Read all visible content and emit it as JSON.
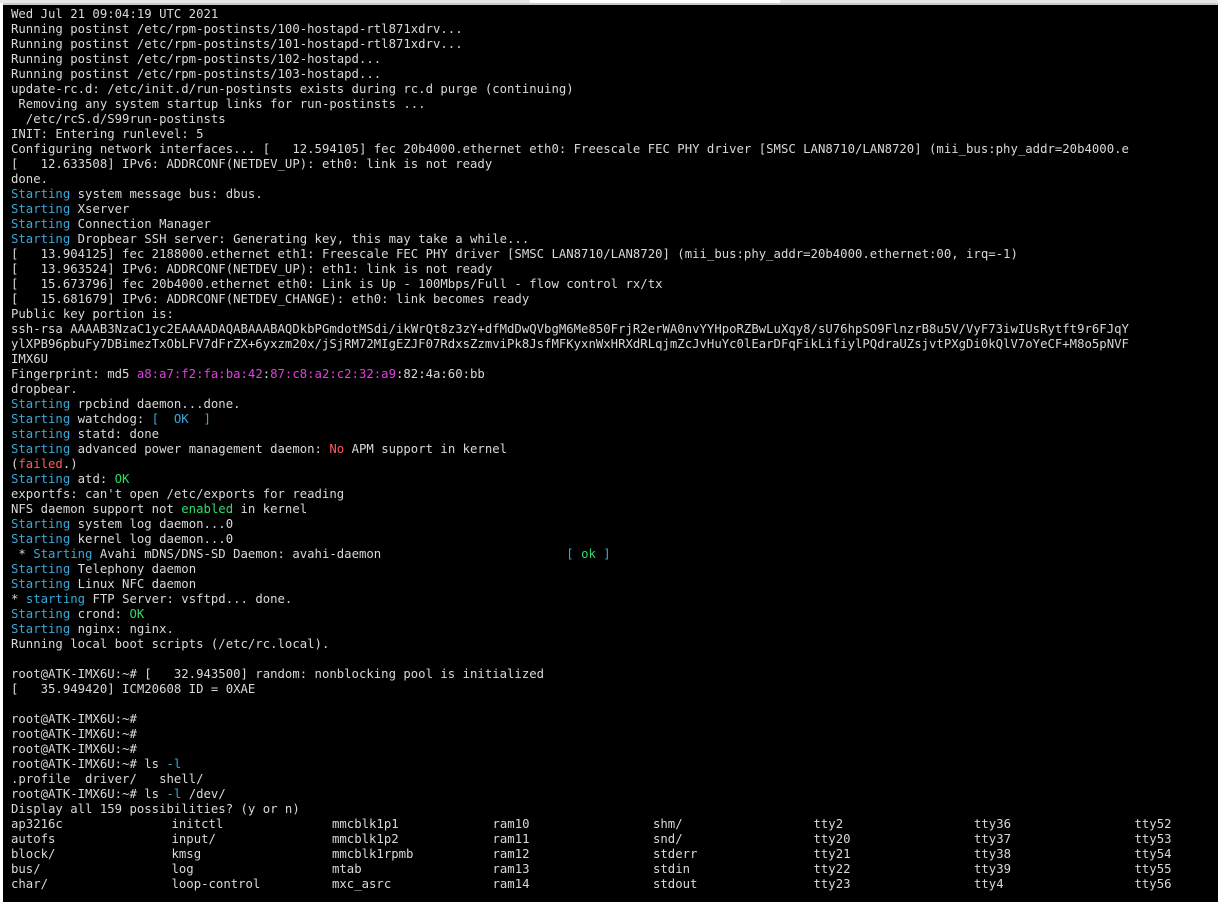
{
  "colors": {
    "default": "#d9d9d9",
    "cyan": "#3aa8d8",
    "green": "#2fdc6a",
    "red": "#ff5a5a",
    "magenta": "#e040e0",
    "background": "#000000"
  },
  "terminal": {
    "lines": [
      [
        {
          "t": "Wed Jul 21 09:04:19 UTC 2021"
        }
      ],
      [
        {
          "t": "Running postinst /etc/rpm-postinsts/100-hostapd-rtl871xdrv..."
        }
      ],
      [
        {
          "t": "Running postinst /etc/rpm-postinsts/101-hostapd-rtl871xdrv..."
        }
      ],
      [
        {
          "t": "Running postinst /etc/rpm-postinsts/102-hostapd..."
        }
      ],
      [
        {
          "t": "Running postinst /etc/rpm-postinsts/103-hostapd..."
        }
      ],
      [
        {
          "t": "update-rc.d: /etc/init.d/run-postinsts exists during rc.d purge (continuing)"
        }
      ],
      [
        {
          "t": " Removing any system startup links for run-postinsts ..."
        }
      ],
      [
        {
          "t": "  /etc/rcS.d/S99run-postinsts"
        }
      ],
      [
        {
          "t": "INIT: Entering runlevel: 5"
        }
      ],
      [
        {
          "t": "Configuring network interfaces... [   12.594105] fec 20b4000.ethernet eth0: Freescale FEC PHY driver [SMSC LAN8710/LAN8720] (mii_bus:phy_addr=20b4000.e"
        }
      ],
      [
        {
          "t": "[   12.633508] IPv6: ADDRCONF(NETDEV_UP): eth0: link is not ready"
        }
      ],
      [
        {
          "t": "done."
        }
      ],
      [
        {
          "t": "Starting",
          "c": "cyan"
        },
        {
          "t": " system message bus: dbus."
        }
      ],
      [
        {
          "t": "Starting",
          "c": "cyan"
        },
        {
          "t": " Xserver"
        }
      ],
      [
        {
          "t": "Starting",
          "c": "cyan"
        },
        {
          "t": " Connection Manager"
        }
      ],
      [
        {
          "t": "Starting",
          "c": "cyan"
        },
        {
          "t": " Dropbear SSH server: Generating key, this may take a while..."
        }
      ],
      [
        {
          "t": "[   13.904125] fec 2188000.ethernet eth1: Freescale FEC PHY driver [SMSC LAN8710/LAN8720] (mii_bus:phy_addr=20b4000.ethernet:00, irq=-1)"
        }
      ],
      [
        {
          "t": "[   13.963524] IPv6: ADDRCONF(NETDEV_UP): eth1: link is not ready"
        }
      ],
      [
        {
          "t": "[   15.673796] fec 20b4000.ethernet eth0: Link is Up - 100Mbps/Full - flow control rx/tx"
        }
      ],
      [
        {
          "t": "[   15.681679] IPv6: ADDRCONF(NETDEV_CHANGE): eth0: link becomes ready"
        }
      ],
      [
        {
          "t": "Public key portion is:"
        }
      ],
      [
        {
          "t": "ssh-rsa AAAAB3NzaC1yc2EAAAADAQABAAABAQDkbPGmdotMSdi/ikWrQt8z3zY+dfMdDwQVbgM6Me850FrjR2erWA0nvYYHpoRZBwLuXqy8/sU76hpSO9FlnzrB8u5V/VyF73iwIUsRytft9r6FJqY"
        }
      ],
      [
        {
          "t": "ylXPB96pbuFy7DBimezTxObLFV7dFrZX+6yxzm20x/jSjRM72MIgEZJF07RdxsZzmviPk8JsfMFKyxnWxHRXdRLqjmZcJvHuYc0lEarDFqFikLifiylPQdraUZsjvtPXgDi0kQlV7oYeCF+M8o5pNVF"
        }
      ],
      [
        {
          "t": "IMX6U"
        }
      ],
      [
        {
          "t": "Fingerprint: md5 "
        },
        {
          "t": "a8:a7:f2:fa:ba:42",
          "c": "magenta"
        },
        {
          "t": ":"
        },
        {
          "t": "87:c8:a2:c2:32:a9",
          "c": "magenta"
        },
        {
          "t": ":82:4a:60:bb"
        }
      ],
      [
        {
          "t": "dropbear."
        }
      ],
      [
        {
          "t": "Starting",
          "c": "cyan"
        },
        {
          "t": " rpcbind daemon...done."
        }
      ],
      [
        {
          "t": "Starting",
          "c": "cyan"
        },
        {
          "t": " watchdog: "
        },
        {
          "t": "[  OK  ]",
          "c": "cyan"
        }
      ],
      [
        {
          "t": "starting",
          "c": "cyan"
        },
        {
          "t": " statd: done"
        }
      ],
      [
        {
          "t": "Starting",
          "c": "cyan"
        },
        {
          "t": " advanced power management daemon: "
        },
        {
          "t": "No",
          "c": "red"
        },
        {
          "t": " APM support in kernel"
        }
      ],
      [
        {
          "t": "("
        },
        {
          "t": "failed",
          "c": "red"
        },
        {
          "t": ".)"
        }
      ],
      [
        {
          "t": "Starting",
          "c": "cyan"
        },
        {
          "t": " atd: "
        },
        {
          "t": "OK",
          "c": "green"
        }
      ],
      [
        {
          "t": "exportfs: can't open /etc/exports for reading"
        }
      ],
      [
        {
          "t": "NFS daemon support not "
        },
        {
          "t": "enabled",
          "c": "green"
        },
        {
          "t": " in kernel"
        }
      ],
      [
        {
          "t": "Starting",
          "c": "cyan"
        },
        {
          "t": " system log daemon...0"
        }
      ],
      [
        {
          "t": "Starting",
          "c": "cyan"
        },
        {
          "t": " kernel log daemon...0"
        }
      ],
      [
        {
          "t": " * "
        },
        {
          "t": "Starting",
          "c": "cyan"
        },
        {
          "t": " Avahi mDNS/DNS-SD Daemon: avahi-daemon                         "
        },
        {
          "t": "[ ",
          "c": "cyan"
        },
        {
          "t": "ok",
          "c": "green"
        },
        {
          "t": " ]",
          "c": "cyan"
        }
      ],
      [
        {
          "t": "Starting",
          "c": "cyan"
        },
        {
          "t": " Telephony daemon"
        }
      ],
      [
        {
          "t": "Starting",
          "c": "cyan"
        },
        {
          "t": " Linux NFC daemon"
        }
      ],
      [
        {
          "t": "* "
        },
        {
          "t": "starting",
          "c": "cyan"
        },
        {
          "t": " FTP Server: vsftpd... done."
        }
      ],
      [
        {
          "t": "Starting",
          "c": "cyan"
        },
        {
          "t": " crond: "
        },
        {
          "t": "OK",
          "c": "green"
        }
      ],
      [
        {
          "t": "Starting",
          "c": "cyan"
        },
        {
          "t": " nginx: nginx."
        }
      ],
      [
        {
          "t": "Running local boot scripts (/etc/rc.local)."
        }
      ],
      [
        {
          "t": ""
        }
      ],
      [
        {
          "t": "root@ATK-IMX6U:~# [   32.943500] random: nonblocking pool is initialized"
        }
      ],
      [
        {
          "t": "[   35.949420] ICM20608 ID = 0XAE"
        }
      ],
      [
        {
          "t": ""
        }
      ],
      [
        {
          "t": "root@ATK-IMX6U:~#"
        }
      ],
      [
        {
          "t": "root@ATK-IMX6U:~#"
        }
      ],
      [
        {
          "t": "root@ATK-IMX6U:~#"
        }
      ],
      [
        {
          "t": "root@ATK-IMX6U:~# ls "
        },
        {
          "t": "-l",
          "c": "cyan"
        }
      ],
      [
        {
          "t": ".profile  driver/   shell/"
        }
      ],
      [
        {
          "t": "root@ATK-IMX6U:~# ls "
        },
        {
          "t": "-l",
          "c": "cyan"
        },
        {
          "t": " /dev/"
        }
      ],
      [
        {
          "t": "Display all 159 possibilities? (y or n)"
        }
      ]
    ],
    "dev_listing": [
      [
        "ap3216c",
        "initctl",
        "mmcblk1p1",
        "ram10",
        "shm/",
        "tty2",
        "tty36",
        "tty52"
      ],
      [
        "autofs",
        "input/",
        "mmcblk1p2",
        "ram11",
        "snd/",
        "tty20",
        "tty37",
        "tty53"
      ],
      [
        "block/",
        "kmsg",
        "mmcblk1rpmb",
        "ram12",
        "stderr",
        "tty21",
        "tty38",
        "tty54"
      ],
      [
        "bus/",
        "log",
        "mtab",
        "ram13",
        "stdin",
        "tty22",
        "tty39",
        "tty55"
      ],
      [
        "char/",
        "loop-control",
        "mxc_asrc",
        "ram14",
        "stdout",
        "tty23",
        "tty4",
        "tty56"
      ]
    ]
  }
}
